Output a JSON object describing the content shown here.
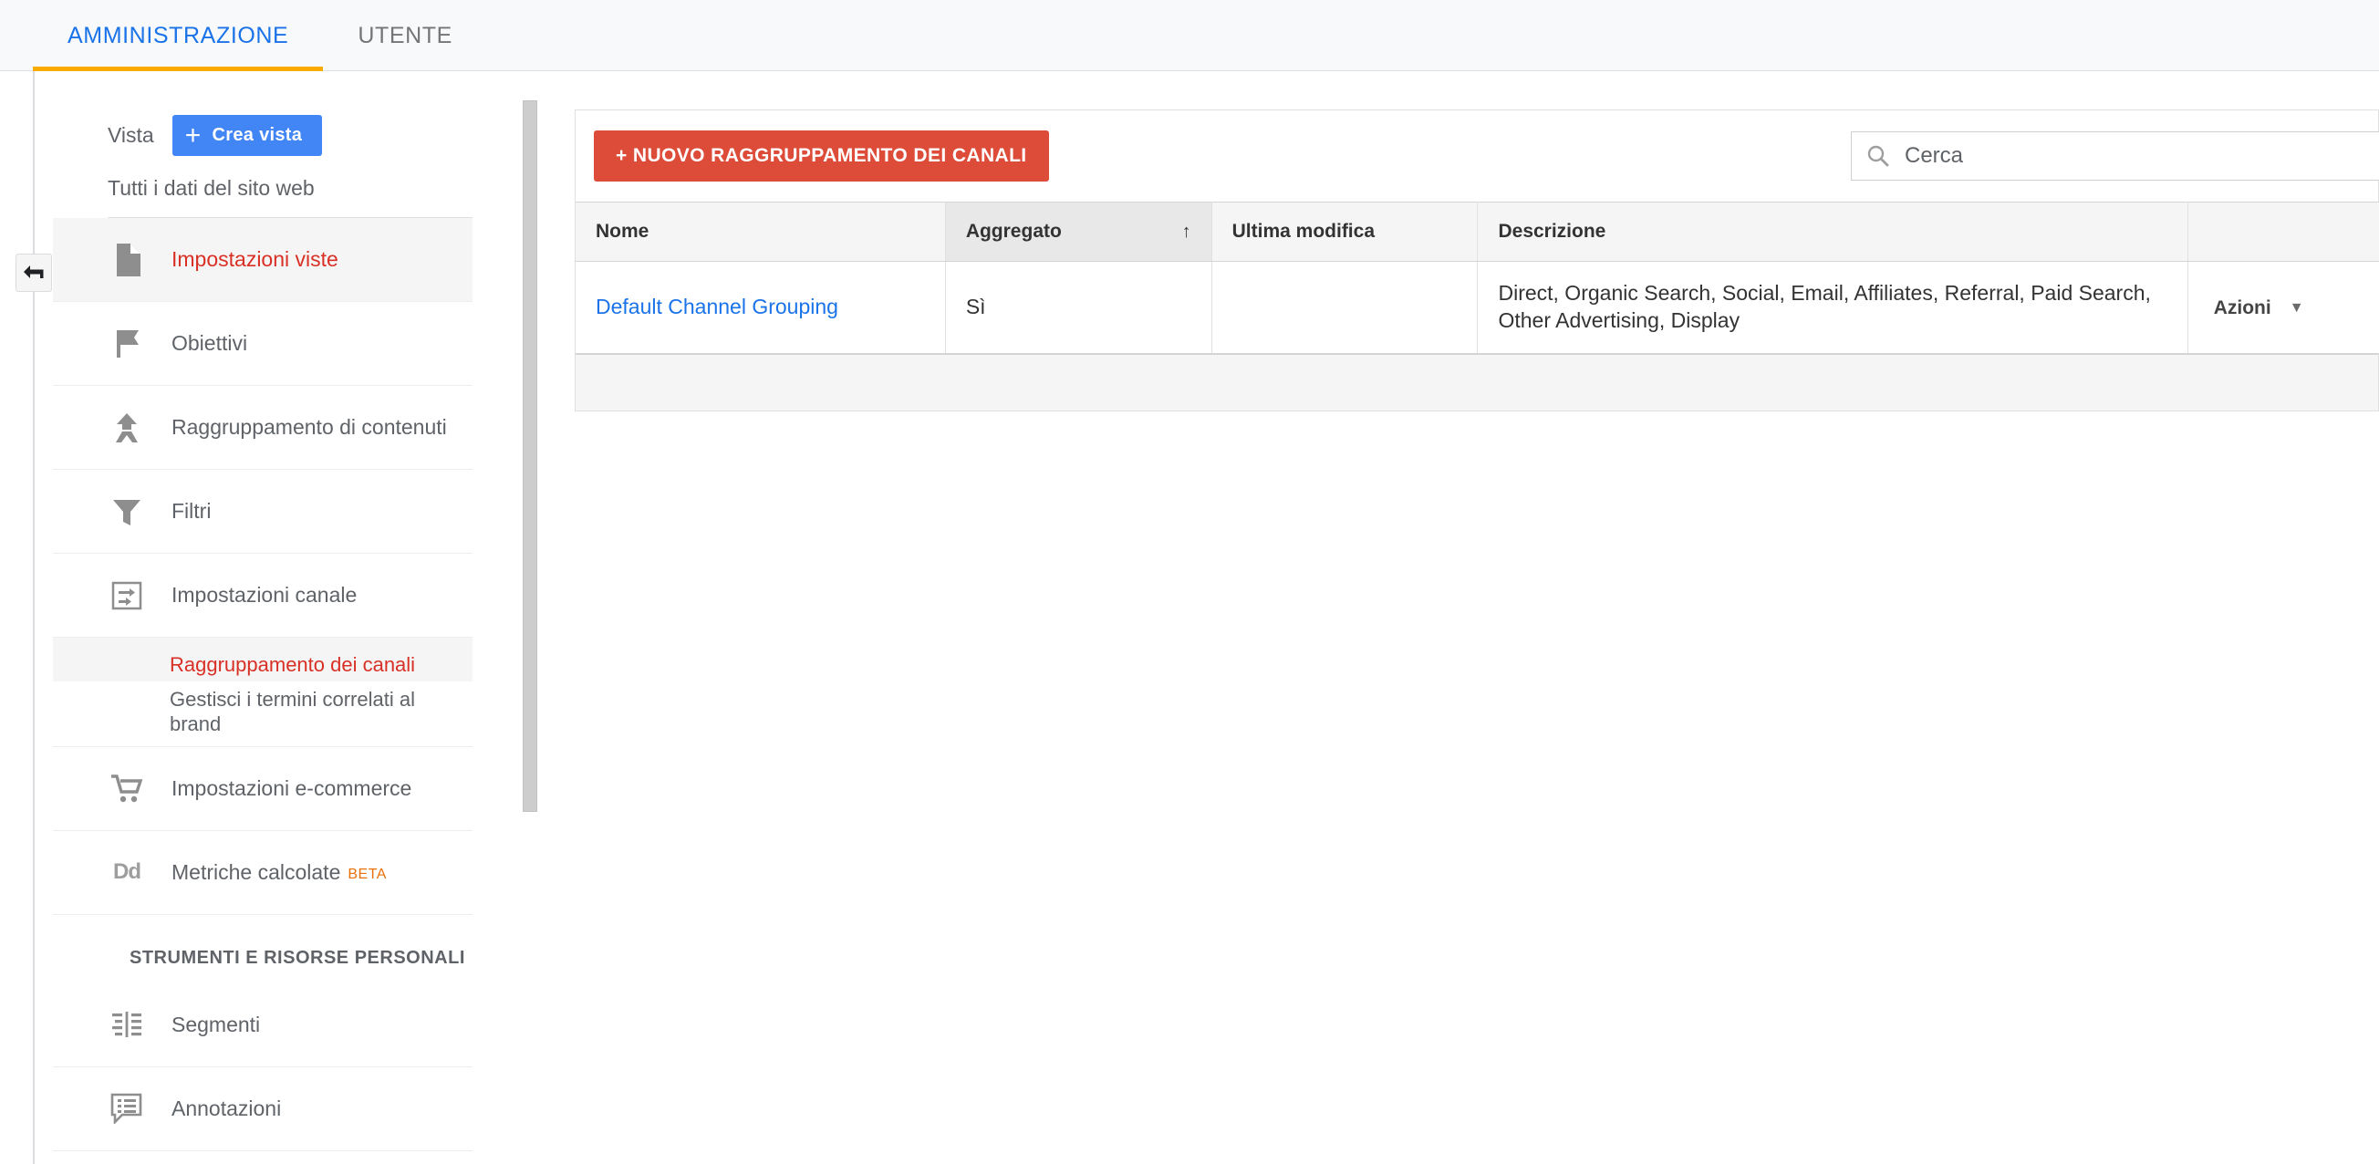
{
  "topbar": {
    "tabs": [
      {
        "label": "AMMINISTRAZIONE",
        "active": true
      },
      {
        "label": "UTENTE",
        "active": false
      }
    ]
  },
  "rail": {
    "collapse_icon": "back-arrow-icon"
  },
  "sidebar": {
    "view_label": "Vista",
    "create_view_button": "Crea vista",
    "create_view_plus": "+",
    "view_name": "Tutti i dati del sito web",
    "items": [
      {
        "label": "Impostazioni viste",
        "icon": "document-icon",
        "selected": true
      },
      {
        "label": "Obiettivi",
        "icon": "flag-icon",
        "selected": false
      },
      {
        "label": "Raggruppamento di contenuti",
        "icon": "content-grouping-icon",
        "selected": false
      },
      {
        "label": "Filtri",
        "icon": "funnel-icon",
        "selected": false
      },
      {
        "label": "Impostazioni canale",
        "icon": "channel-settings-icon",
        "selected": false
      }
    ],
    "sub_items": [
      {
        "label": "Raggruppamento dei canali",
        "active": true
      },
      {
        "label": "Gestisci i termini correlati al brand",
        "active": false
      }
    ],
    "items_after": [
      {
        "label": "Impostazioni e-commerce",
        "icon": "cart-icon",
        "selected": false
      },
      {
        "label": "Metriche calcolate",
        "icon": "dd-icon",
        "badge": "BETA",
        "selected": false
      }
    ],
    "section_header": "STRUMENTI E RISORSE PERSONALI",
    "tools_items": [
      {
        "label": "Segmenti",
        "icon": "segments-icon",
        "selected": false
      },
      {
        "label": "Annotazioni",
        "icon": "annotations-icon",
        "selected": false
      }
    ]
  },
  "main": {
    "new_button": "+ NUOVO RAGGRUPPAMENTO DEI CANALI",
    "search": {
      "placeholder": "Cerca",
      "value": "",
      "icon": "search-icon"
    },
    "table": {
      "columns": [
        {
          "label": "Nome",
          "sorted": false
        },
        {
          "label": "Aggregato",
          "sorted": true,
          "sort_arrow": "↑"
        },
        {
          "label": "Ultima modifica",
          "sorted": false
        },
        {
          "label": "Descrizione",
          "sorted": false
        },
        {
          "label": "",
          "sorted": false
        }
      ],
      "rows": [
        {
          "nome": "Default Channel Grouping",
          "aggregato": "Sì",
          "ultima_modifica": "",
          "descrizione": "Direct, Organic Search, Social, Email, Affiliates, Referral, Paid Search, Other Advertising, Display",
          "azioni": "Azioni"
        }
      ]
    }
  },
  "colors": {
    "accent_blue": "#1a73e8",
    "tab_underline": "#f9ab00",
    "danger_red": "#dd4b39",
    "selected_red": "#d93025",
    "button_blue": "#4285f4",
    "beta_orange": "#e8710a"
  }
}
